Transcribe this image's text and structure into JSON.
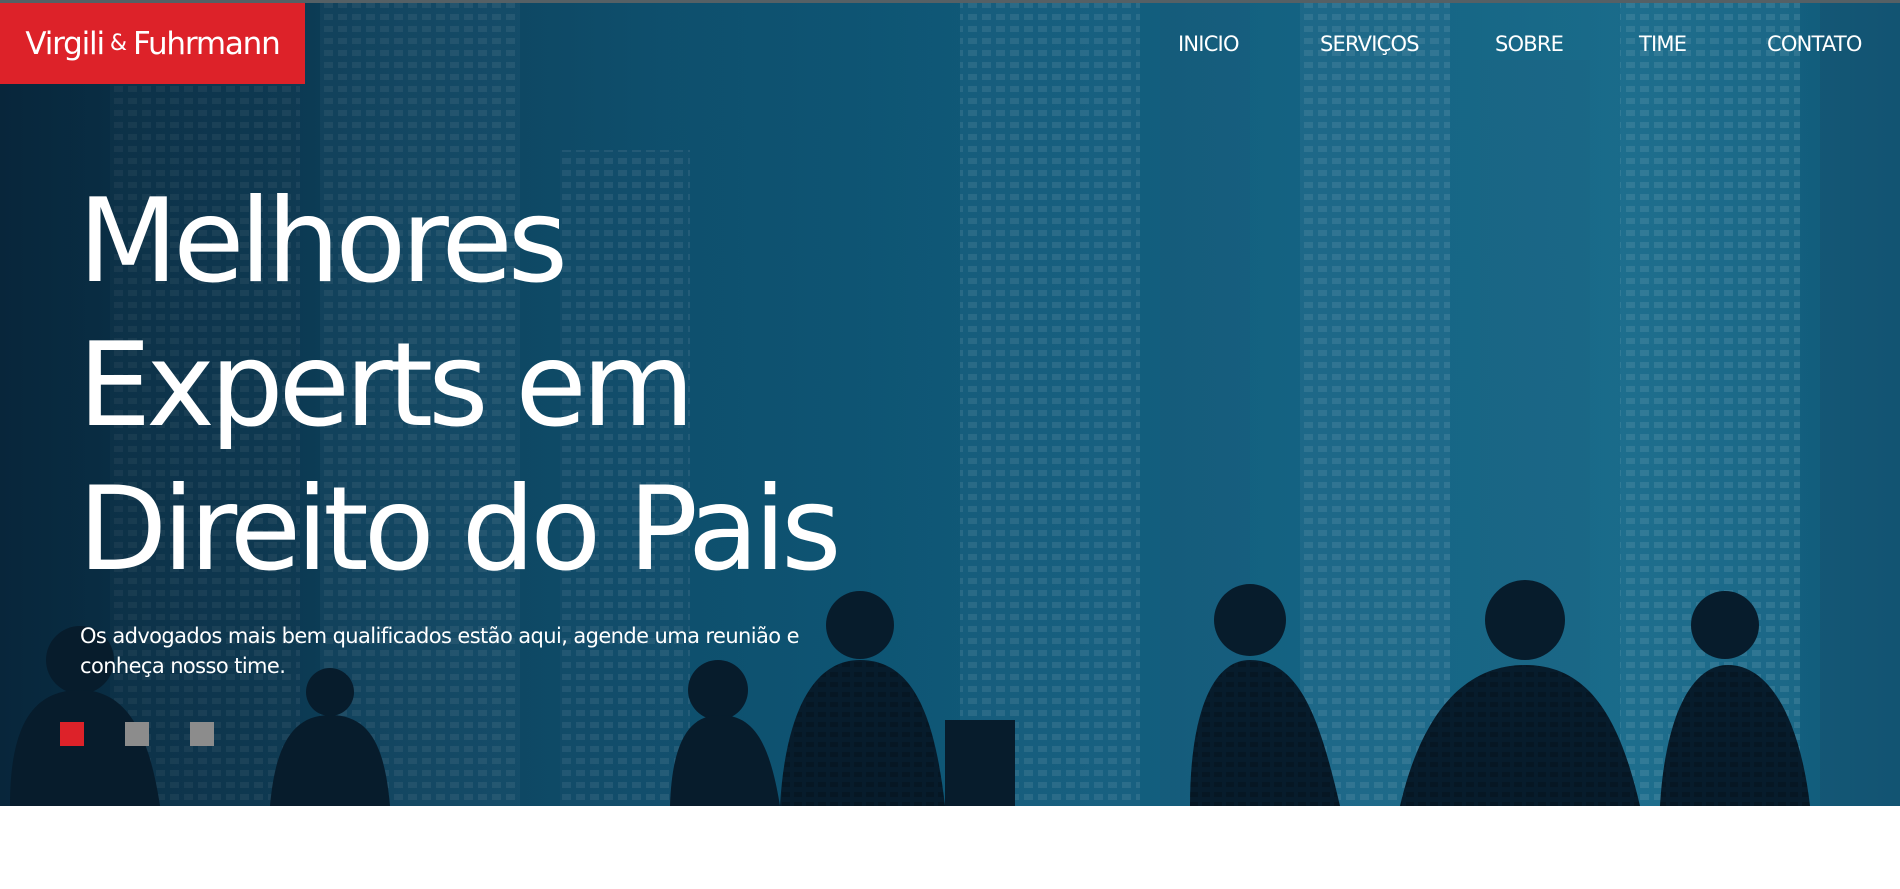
{
  "header": {
    "logo": {
      "first": "Virgili",
      "amp": "&",
      "last": "Fuhrmann"
    },
    "nav": [
      {
        "label": "INICIO"
      },
      {
        "label": "SERVIÇOS"
      },
      {
        "label": "SOBRE"
      },
      {
        "label": "TIME"
      },
      {
        "label": "CONTATO"
      }
    ]
  },
  "hero": {
    "headline_lines": [
      "Melhores",
      "Experts em",
      "Direito do Pais"
    ],
    "subtitle": "Os advogados mais bem qualificados estão aqui, agende uma reunião e conheça nosso time.",
    "slider": {
      "count": 3,
      "active": 1
    }
  },
  "colors": {
    "brand_red": "#dd2229",
    "hero_blue": "#0f5a7a",
    "dot_inactive": "#8c8c8c"
  }
}
